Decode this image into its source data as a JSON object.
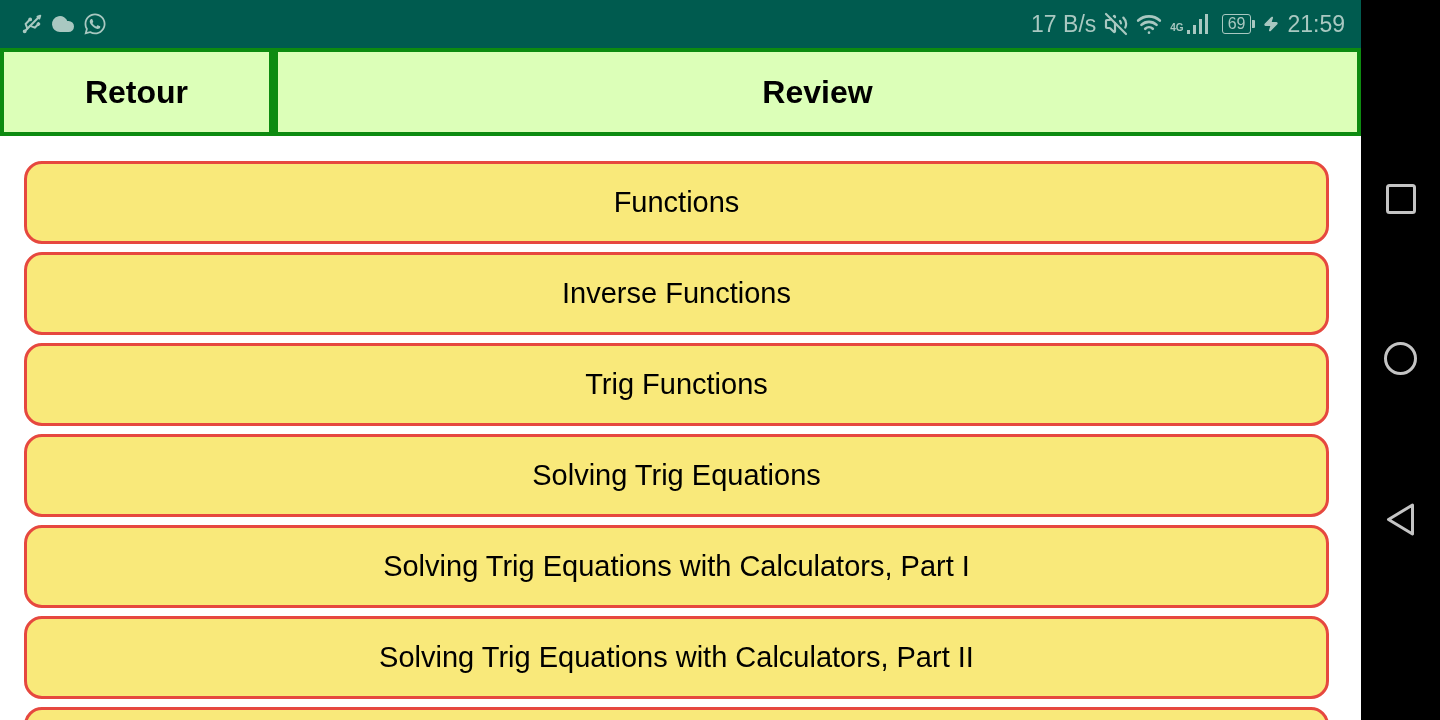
{
  "status_bar": {
    "network_speed": "17 B/s",
    "network_type": "4G",
    "battery": "69",
    "charging": true,
    "time": "21:59"
  },
  "header": {
    "back_label": "Retour",
    "title": "Review"
  },
  "topics": [
    {
      "label": "Functions"
    },
    {
      "label": "Inverse Functions"
    },
    {
      "label": "Trig Functions"
    },
    {
      "label": "Solving Trig Equations"
    },
    {
      "label": "Solving Trig Equations with Calculators, Part I"
    },
    {
      "label": "Solving Trig Equations with Calculators, Part II"
    }
  ],
  "more_below": true
}
